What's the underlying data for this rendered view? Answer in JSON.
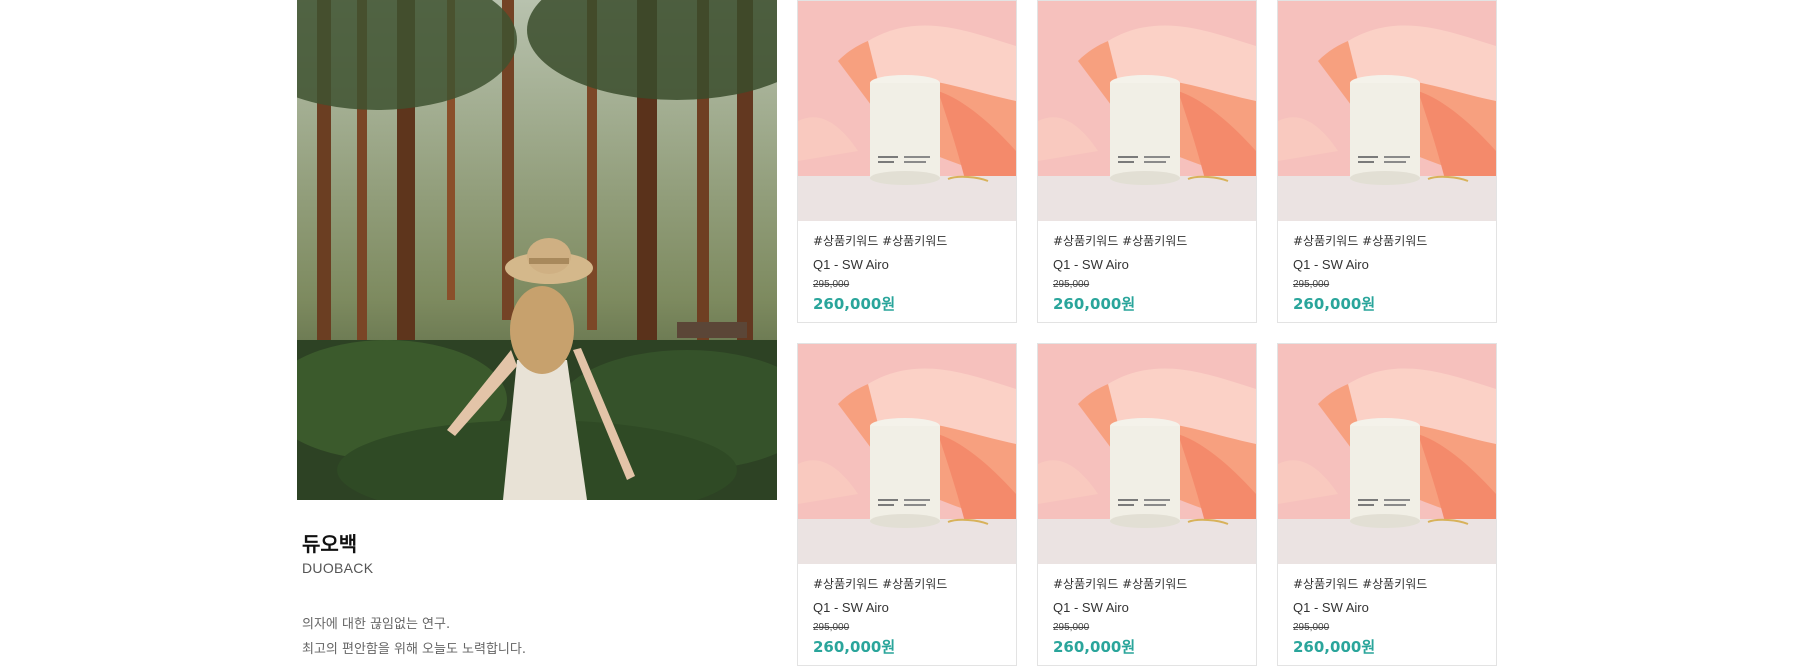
{
  "brand": {
    "name": "듀오백",
    "subtitle": "DUOBACK",
    "description": [
      "의자에 대한 끊임없는 연구.",
      "최고의 편안함을 위해 오늘도 노력합니다."
    ]
  },
  "products": [
    {
      "keywords": "#상품키워드 #상품키워드",
      "name": "Q1 - SW Airo",
      "original_price": "295,000",
      "price": "260,000원"
    },
    {
      "keywords": "#상품키워드 #상품키워드",
      "name": "Q1 - SW Airo",
      "original_price": "295,000",
      "price": "260,000원"
    },
    {
      "keywords": "#상품키워드 #상품키워드",
      "name": "Q1 - SW Airo",
      "original_price": "295,000",
      "price": "260,000원"
    },
    {
      "keywords": "#상품키워드 #상품키워드",
      "name": "Q1 - SW Airo",
      "original_price": "295,000",
      "price": "260,000원"
    },
    {
      "keywords": "#상품키워드 #상품키워드",
      "name": "Q1 - SW Airo",
      "original_price": "295,000",
      "price": "260,000원"
    },
    {
      "keywords": "#상품키워드 #상품키워드",
      "name": "Q1 - SW Airo",
      "original_price": "295,000",
      "price": "260,000원"
    }
  ],
  "colors": {
    "price_accent": "#2aa59b",
    "card_border": "#e3e3e3"
  }
}
